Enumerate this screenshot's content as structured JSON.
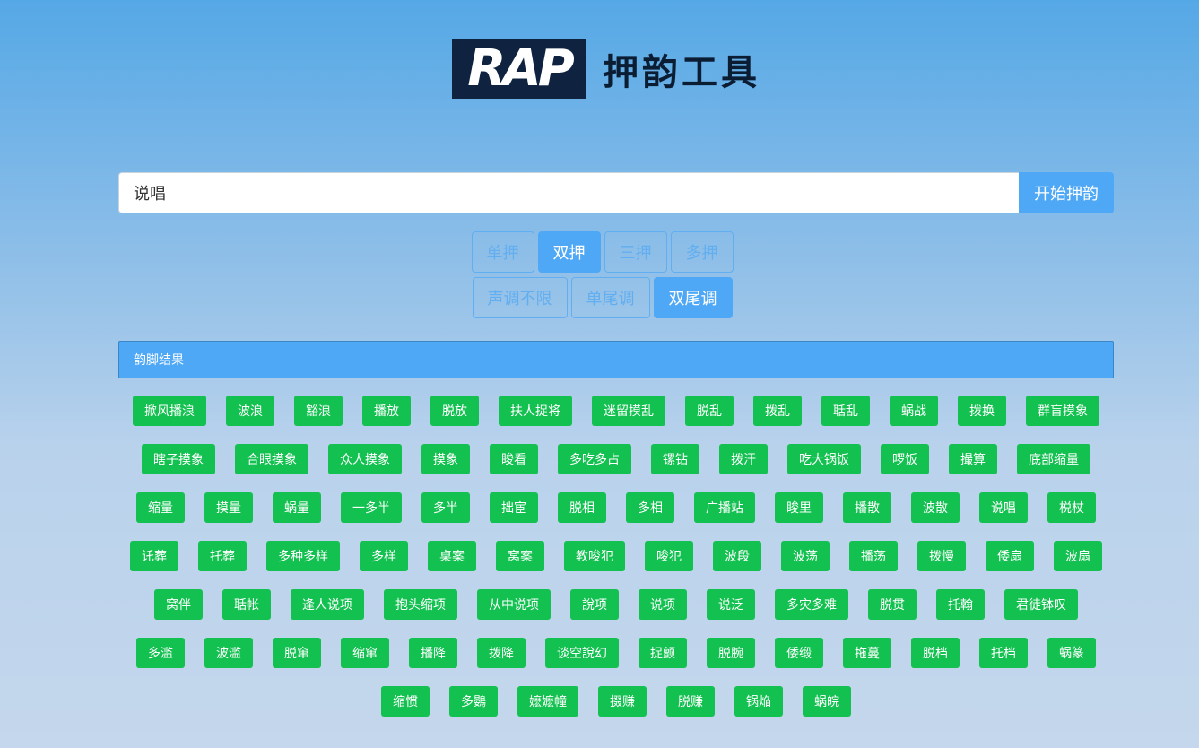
{
  "header": {
    "logo_text": "RAP",
    "title": "押韵工具"
  },
  "search": {
    "value": "说唱",
    "button_label": "开始押韵"
  },
  "rhyme_options": [
    {
      "label": "单押",
      "active": false
    },
    {
      "label": "双押",
      "active": true
    },
    {
      "label": "三押",
      "active": false
    },
    {
      "label": "多押",
      "active": false
    }
  ],
  "tone_options": [
    {
      "label": "声调不限",
      "active": false
    },
    {
      "label": "单尾调",
      "active": false
    },
    {
      "label": "双尾调",
      "active": true
    }
  ],
  "results": {
    "heading": "韵脚结果",
    "rows": [
      [
        "掀风播浪",
        "波浪",
        "豁浪",
        "播放",
        "脱放",
        "扶人捉将",
        "迷留摸乱",
        "脱乱",
        "拨乱",
        "聒乱",
        "蜗战",
        "拨换",
        "群盲摸象"
      ],
      [
        "瞎子摸象",
        "合眼摸象",
        "众人摸象",
        "摸象",
        "睃看",
        "多吃多占",
        "镙钻",
        "拨汗",
        "吃大锅饭",
        "啰饭",
        "撮算",
        "底部缩量"
      ],
      [
        "缩量",
        "摸量",
        "蜗量",
        "一多半",
        "多半",
        "拙宦",
        "脱相",
        "多相",
        "广播站",
        "睃里",
        "播散",
        "波散",
        "说唱",
        "棁杖"
      ],
      [
        "讬葬",
        "托葬",
        "多种多样",
        "多样",
        "桌案",
        "窝案",
        "教唆犯",
        "唆犯",
        "波段",
        "波荡",
        "播荡",
        "拨慢",
        "倭扇",
        "波扇"
      ],
      [
        "窝伴",
        "聒帐",
        "逢人说项",
        "抱头缩项",
        "从中说项",
        "說项",
        "说项",
        "说泛",
        "多灾多难",
        "脱贯",
        "托翰",
        "君徒钵叹"
      ],
      [
        "多滥",
        "波滥",
        "脱窜",
        "缩窜",
        "播降",
        "拨降",
        "谈空說幻",
        "捉颤",
        "脱腕",
        "倭缎",
        "拖蔓",
        "脱档",
        "托档",
        "蜗篆"
      ],
      [
        "缩惯",
        "多鷃",
        "嬷嬷幢",
        "掇赚",
        "脱赚",
        "锅焔",
        "蜗皖"
      ]
    ]
  },
  "colors": {
    "accent": "#4fa8f5",
    "tag_green": "#13c150",
    "logo_bg": "#0f2340"
  }
}
